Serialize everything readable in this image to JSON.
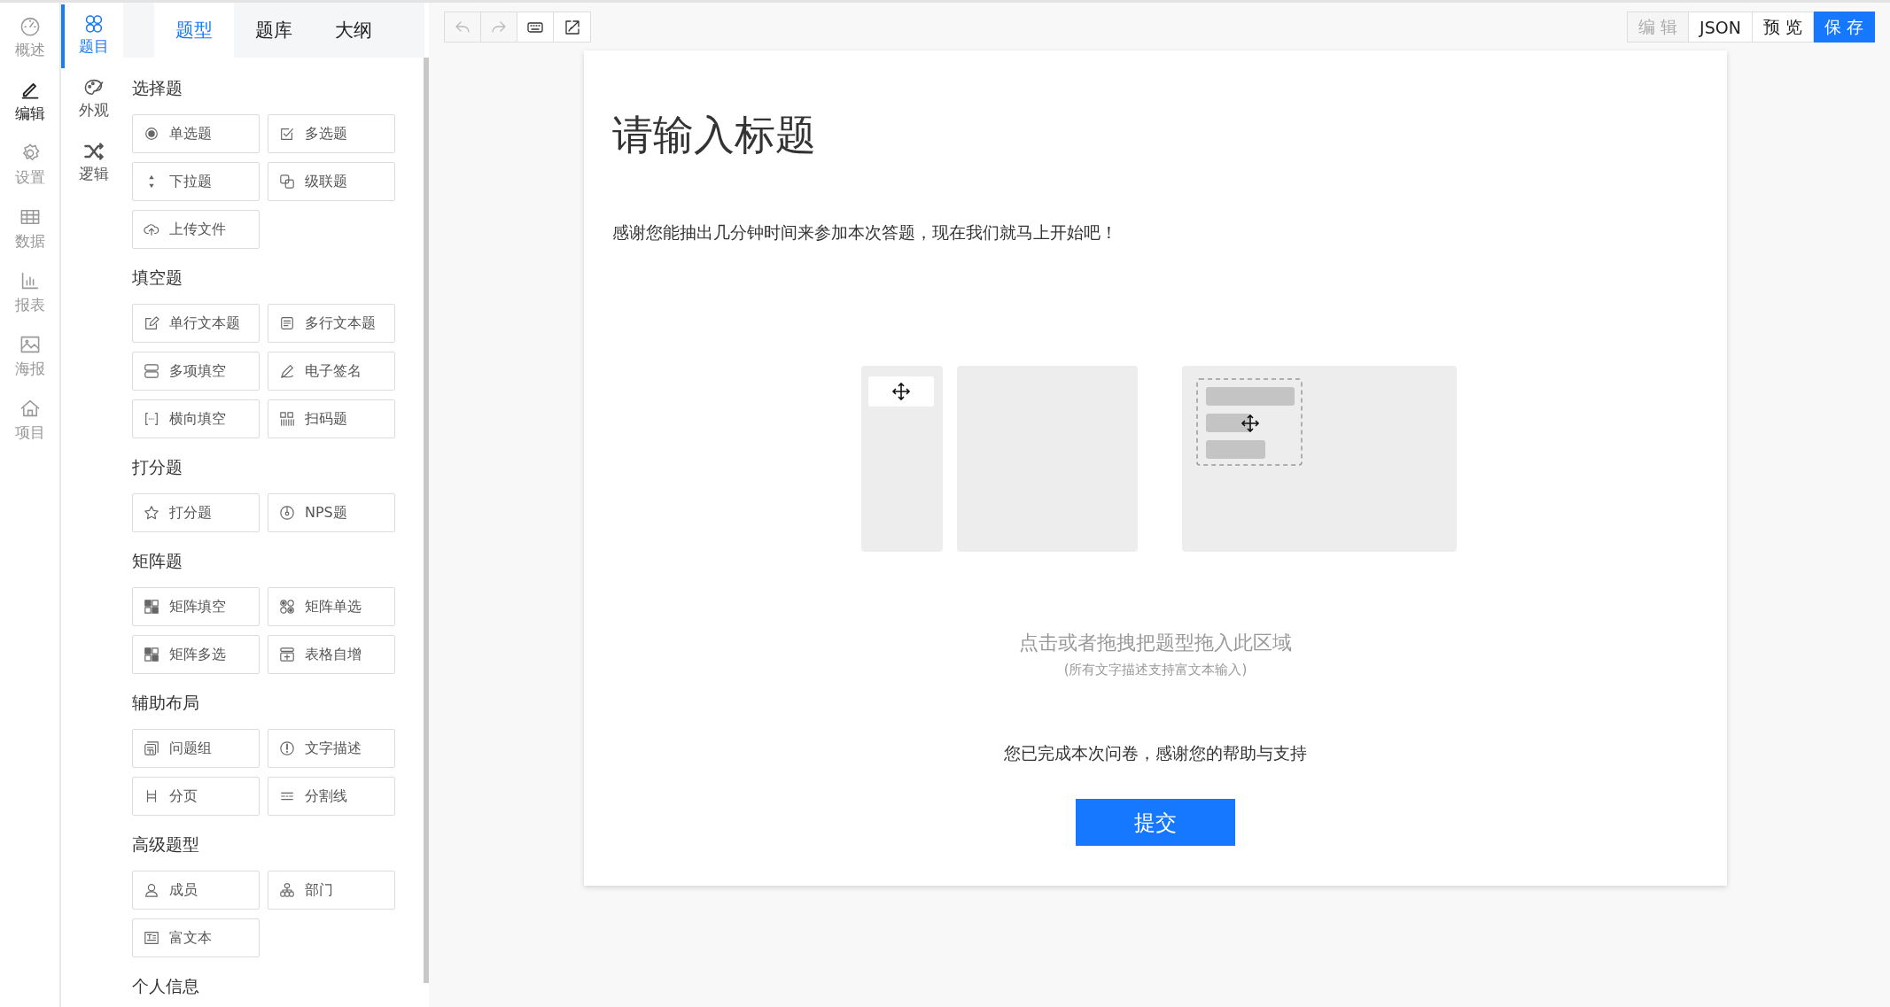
{
  "nav": [
    {
      "label": "概述",
      "kind": "overview",
      "selected": false
    },
    {
      "label": "编辑",
      "kind": "edit",
      "selected": true
    },
    {
      "label": "设置",
      "kind": "settings",
      "selected": false
    },
    {
      "label": "数据",
      "kind": "data",
      "selected": false
    },
    {
      "label": "报表",
      "kind": "report",
      "selected": false
    },
    {
      "label": "海报",
      "kind": "poster",
      "selected": false
    },
    {
      "label": "项目",
      "kind": "project",
      "selected": false
    }
  ],
  "subnav": [
    {
      "label": "题目",
      "kind": "questions",
      "selected": true
    },
    {
      "label": "外观",
      "kind": "appearance",
      "selected": false
    },
    {
      "label": "逻辑",
      "kind": "logic",
      "selected": false
    }
  ],
  "tabs": [
    {
      "label": "题型",
      "selected": true
    },
    {
      "label": "题库",
      "selected": false
    },
    {
      "label": "大纲",
      "selected": false
    }
  ],
  "palette": [
    {
      "heading": "选择题",
      "items": [
        {
          "label": "单选题",
          "kind": "radio"
        },
        {
          "label": "多选题",
          "kind": "checkbox"
        },
        {
          "label": "下拉题",
          "kind": "select"
        },
        {
          "label": "级联题",
          "kind": "cascade"
        },
        {
          "label": "上传文件",
          "kind": "upload"
        }
      ]
    },
    {
      "heading": "填空题",
      "items": [
        {
          "label": "单行文本题",
          "kind": "text"
        },
        {
          "label": "多行文本题",
          "kind": "textarea"
        },
        {
          "label": "多项填空",
          "kind": "multi-fill"
        },
        {
          "label": "电子签名",
          "kind": "signature"
        },
        {
          "label": "横向填空",
          "kind": "inline-fill"
        },
        {
          "label": "扫码题",
          "kind": "scan"
        }
      ]
    },
    {
      "heading": "打分题",
      "items": [
        {
          "label": "打分题",
          "kind": "star"
        },
        {
          "label": "NPS题",
          "kind": "nps"
        }
      ]
    },
    {
      "heading": "矩阵题",
      "items": [
        {
          "label": "矩阵填空",
          "kind": "matrix-fill"
        },
        {
          "label": "矩阵单选",
          "kind": "matrix-radio"
        },
        {
          "label": "矩阵多选",
          "kind": "matrix-check"
        },
        {
          "label": "表格自增",
          "kind": "table"
        }
      ]
    },
    {
      "heading": "辅助布局",
      "items": [
        {
          "label": "问题组",
          "kind": "group"
        },
        {
          "label": "文字描述",
          "kind": "notice"
        },
        {
          "label": "分页",
          "kind": "page"
        },
        {
          "label": "分割线",
          "kind": "divider"
        }
      ]
    },
    {
      "heading": "高级题型",
      "items": [
        {
          "label": "成员",
          "kind": "member"
        },
        {
          "label": "部门",
          "kind": "department"
        },
        {
          "label": "富文本",
          "kind": "richtext"
        }
      ]
    },
    {
      "heading": "个人信息"
    }
  ],
  "toolbar": {
    "tools": [
      {
        "kind": "undo",
        "disabled": true
      },
      {
        "kind": "redo",
        "disabled": true
      },
      {
        "kind": "keyboard",
        "disabled": false
      },
      {
        "kind": "export",
        "disabled": false
      }
    ],
    "buttons": [
      {
        "label": "编 辑",
        "kind": "disabled"
      },
      {
        "label": "JSON",
        "kind": "default"
      },
      {
        "label": "预 览",
        "kind": "default"
      },
      {
        "label": "保 存",
        "kind": "primary"
      }
    ]
  },
  "survey": {
    "title": "请输入标题",
    "description": "感谢您能抽出几分钟时间来参加本次答题，现在我们就马上开始吧！",
    "drop_hint": "点击或者拖拽把题型拖入此区域",
    "drop_note": "(所有文字描述支持富文本输入)",
    "finish": "您已完成本次问卷，感谢您的帮助与支持",
    "submit": "提交"
  }
}
